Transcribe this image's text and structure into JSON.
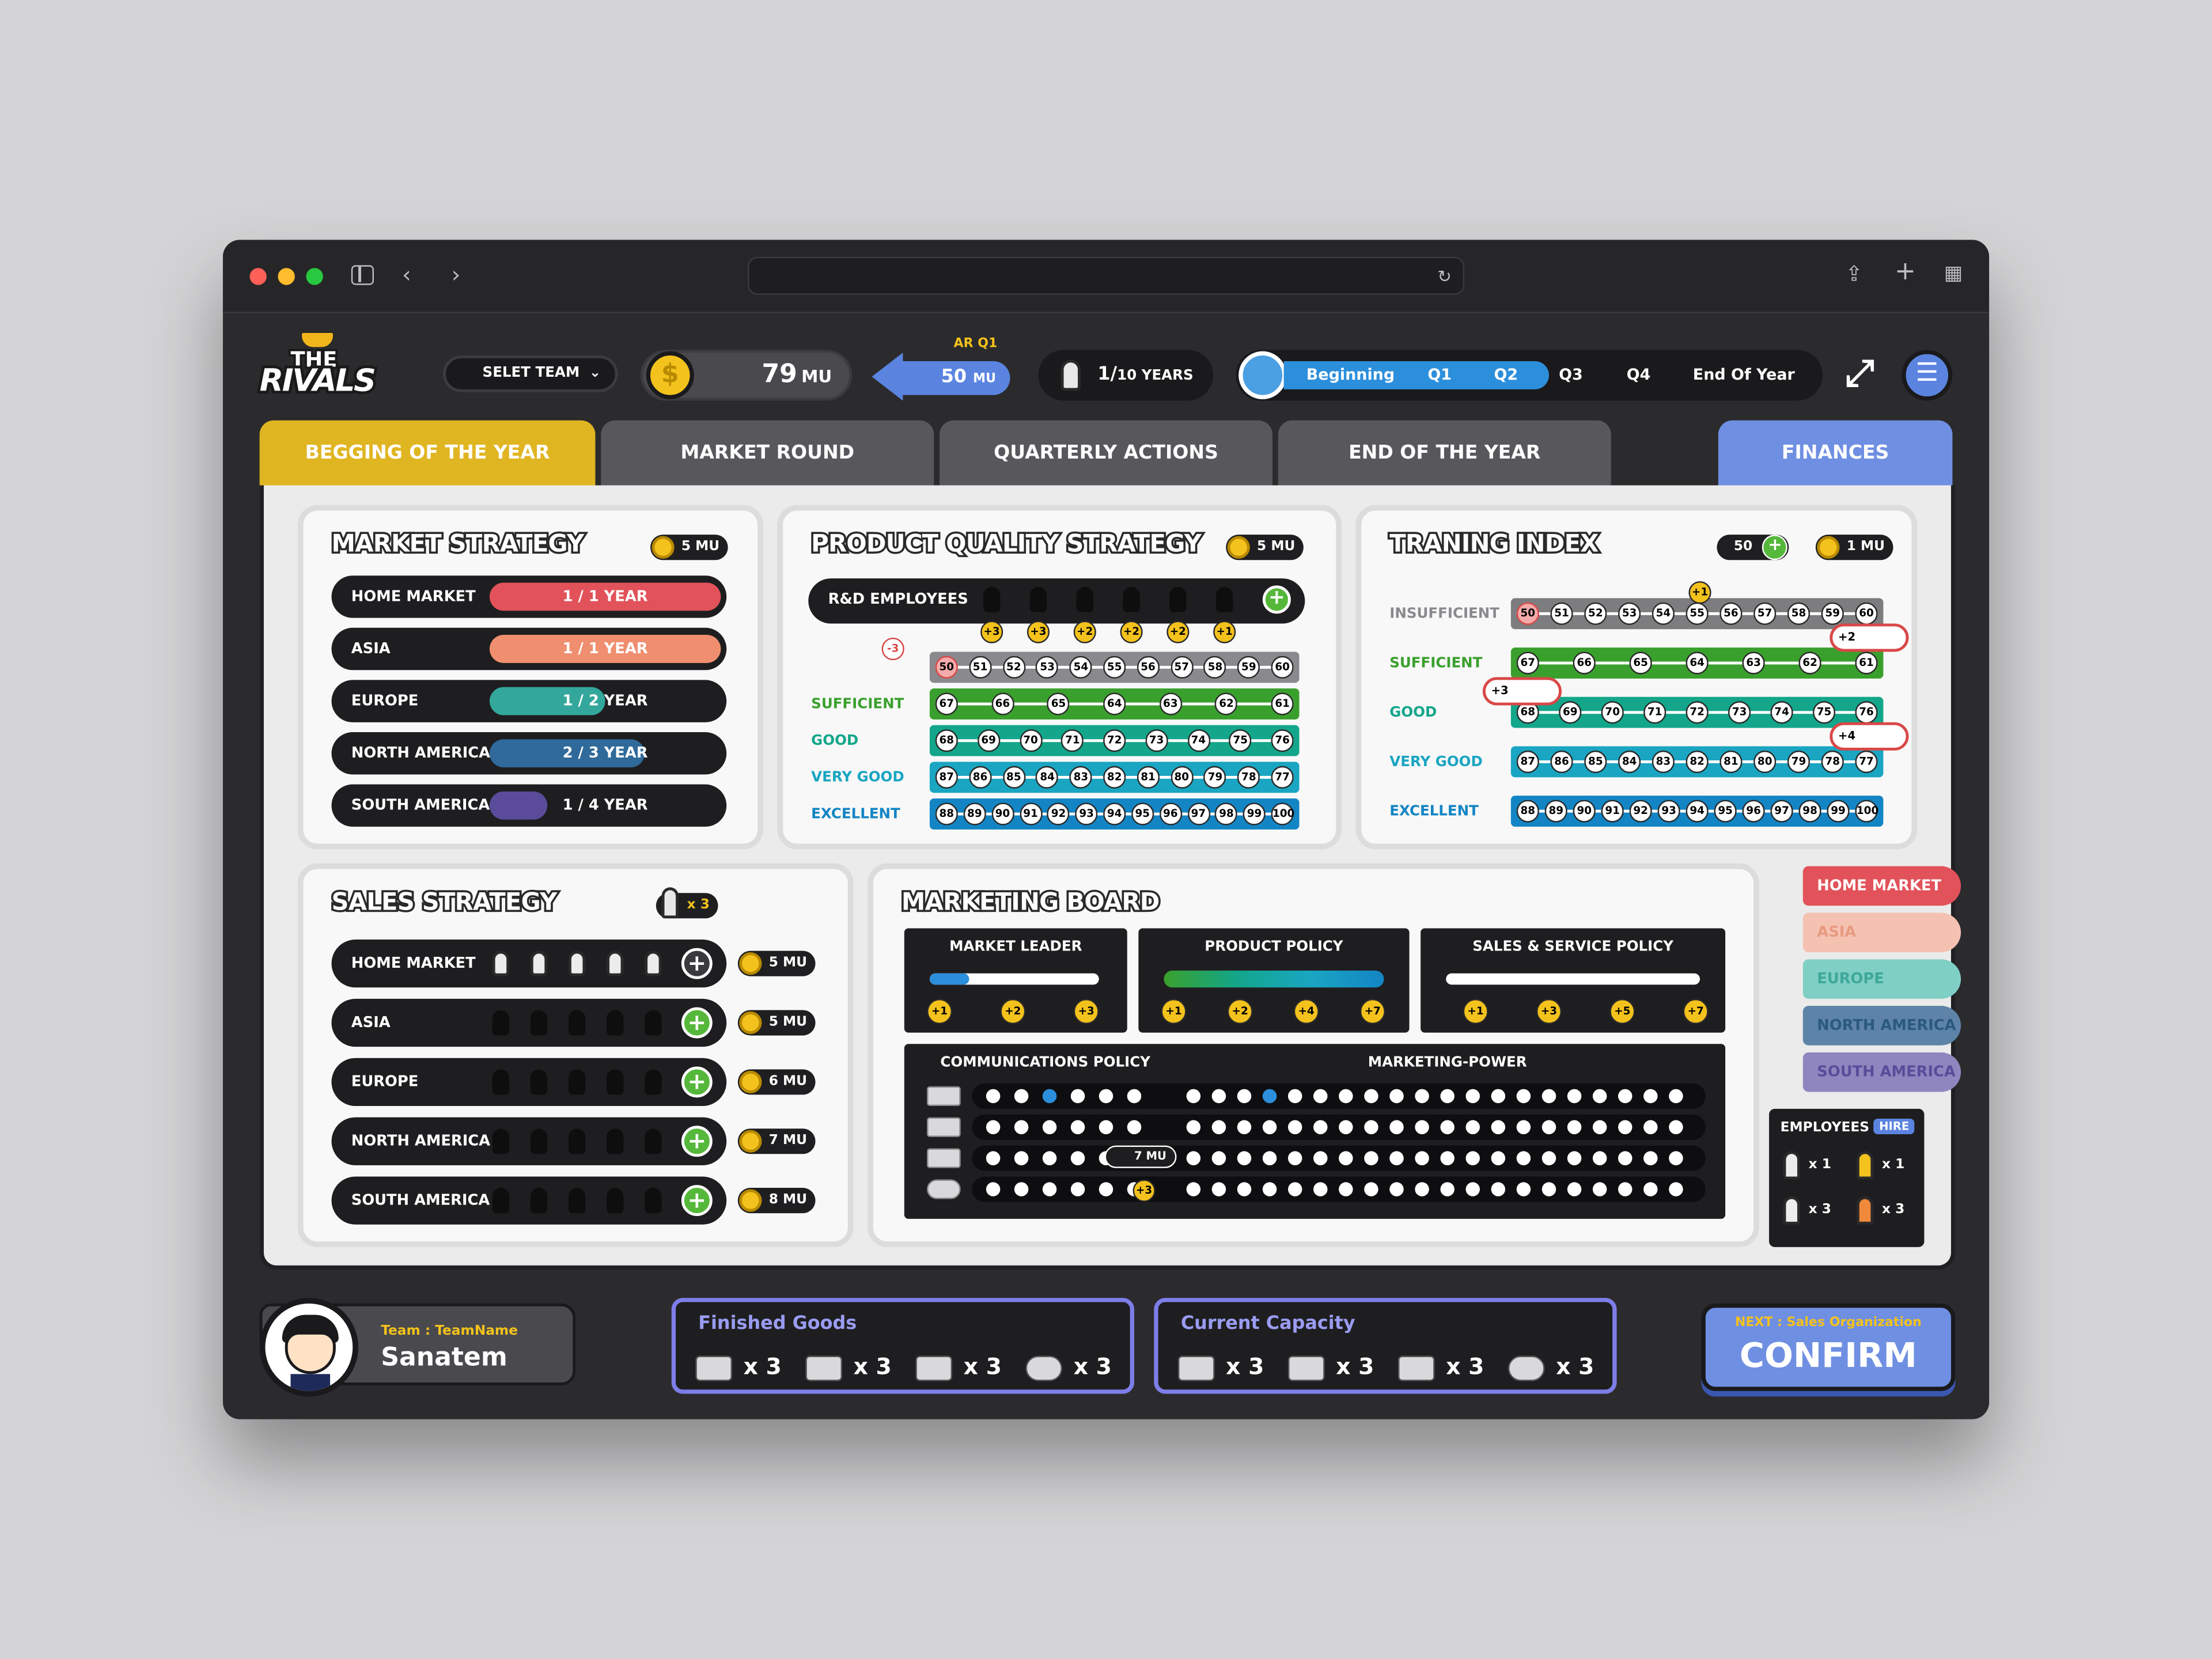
{
  "app": {
    "logo_line1": "THE",
    "logo_line2": "RIVALS",
    "team_select": "SELET TEAM",
    "money": "79",
    "money_unit": "MU",
    "ar_label": "AR Q1",
    "ar_value": "50",
    "ar_unit": "MU",
    "years": "1/",
    "years_suffix": "10 YEARS"
  },
  "timeline": {
    "phases": [
      "Beginning",
      "Q1",
      "Q2",
      "Q3",
      "Q4",
      "End Of Year"
    ],
    "active_through": 2
  },
  "tabs": [
    "BEGGING OF THE YEAR",
    "MARKET ROUND",
    "QUARTERLY ACTIONS",
    "END OF THE YEAR",
    "FINANCES"
  ],
  "market_strategy": {
    "title": "MARKET STRATEGY",
    "cost": "5 MU",
    "rows": [
      {
        "label": "HOME MARKET",
        "value": "1 / 1 YEAR",
        "fill": 1.0,
        "color": "#e2525a"
      },
      {
        "label": "ASIA",
        "value": "1 / 1 YEAR",
        "fill": 1.0,
        "color": "#ef8f6f"
      },
      {
        "label": "EUROPE",
        "value": "1 / 2 YEAR",
        "fill": 0.5,
        "color": "#34a79c"
      },
      {
        "label": "NORTH AMERICA",
        "value": "2 / 3 YEAR",
        "fill": 0.67,
        "color": "#2f6a9a"
      },
      {
        "label": "SOUTH AMERICA",
        "value": "1 / 4 YEAR",
        "fill": 0.25,
        "color": "#5a4c9a"
      }
    ]
  },
  "product_quality": {
    "title": "PRODUCT QUALITY STRATEGY",
    "cost": "5 MU",
    "rd_label": "R&D EMPLOYEES",
    "bonuses": [
      "+3",
      "+3",
      "+2",
      "+2",
      "+2",
      "+1"
    ],
    "penalty": "-3",
    "levels": [
      {
        "label": "SUFFICIENT",
        "color": "#3aa02d",
        "nums": [
          "67",
          "66",
          "65",
          "64",
          "63",
          "62",
          "61"
        ]
      },
      {
        "label": "GOOD",
        "color": "#13a68a",
        "nums": [
          "68",
          "69",
          "70",
          "71",
          "72",
          "73",
          "74",
          "75",
          "76"
        ]
      },
      {
        "label": "VERY GOOD",
        "color": "#1aa5c2",
        "nums": [
          "87",
          "86",
          "85",
          "84",
          "83",
          "82",
          "81",
          "80",
          "79",
          "78",
          "77"
        ]
      },
      {
        "label": "EXCELLENT",
        "color": "#1385c4",
        "nums": [
          "88",
          "89",
          "90",
          "91",
          "92",
          "93",
          "94",
          "95",
          "96",
          "97",
          "98",
          "99",
          "100"
        ]
      }
    ],
    "insufficient": [
      "50",
      "51",
      "52",
      "53",
      "54",
      "55",
      "56",
      "57",
      "58",
      "59",
      "60"
    ]
  },
  "training": {
    "title": "TRANING INDEX",
    "index": "50",
    "cost": "1 MU",
    "bonus": "+1",
    "markers": [
      "+2",
      "+3",
      "+4"
    ],
    "levels": [
      {
        "label": "INSUFFICIENT",
        "color": "#7d7d80",
        "nums": [
          "50",
          "51",
          "52",
          "53",
          "54",
          "55",
          "56",
          "57",
          "58",
          "59",
          "60"
        ]
      },
      {
        "label": "SUFFICIENT",
        "color": "#3aa02d",
        "nums": [
          "67",
          "66",
          "65",
          "64",
          "63",
          "62",
          "61"
        ]
      },
      {
        "label": "GOOD",
        "color": "#13a68a",
        "nums": [
          "68",
          "69",
          "70",
          "71",
          "72",
          "73",
          "74",
          "75",
          "76"
        ]
      },
      {
        "label": "VERY GOOD",
        "color": "#1aa5c2",
        "nums": [
          "87",
          "86",
          "85",
          "84",
          "83",
          "82",
          "81",
          "80",
          "79",
          "78",
          "77"
        ]
      },
      {
        "label": "EXCELLENT",
        "color": "#1385c4",
        "nums": [
          "88",
          "89",
          "90",
          "91",
          "92",
          "93",
          "94",
          "95",
          "96",
          "97",
          "98",
          "99",
          "100"
        ]
      }
    ]
  },
  "sales_strategy": {
    "title": "SALES STRATEGY",
    "badge": "x 3",
    "rows": [
      {
        "label": "HOME MARKET",
        "cost": "5 MU"
      },
      {
        "label": "ASIA",
        "cost": "5 MU"
      },
      {
        "label": "EUROPE",
        "cost": "6 MU"
      },
      {
        "label": "NORTH AMERICA",
        "cost": "7 MU"
      },
      {
        "label": "SOUTH AMERICA",
        "cost": "8 MU"
      }
    ]
  },
  "marketing_board": {
    "title": "MARKETING BOARD",
    "market_leader": {
      "title": "MARKET LEADER",
      "bonuses": [
        "+1",
        "+2",
        "+3"
      ]
    },
    "product_policy": {
      "title": "PRODUCT POLICY",
      "bonuses": [
        "+1",
        "+2",
        "+4",
        "+7"
      ]
    },
    "sales_service": {
      "title": "SALES & SERVICE POLICY",
      "bonuses": [
        "+1",
        "+3",
        "+5",
        "+7"
      ]
    },
    "comm_title": "COMMUNICATIONS POLICY",
    "power_title": "MARKETING-POWER",
    "cost_chip": "7 MU",
    "bonus_chip": "+3"
  },
  "regions": [
    {
      "label": "HOME MARKET",
      "bg": "#e2525a",
      "fg": "#ffffff"
    },
    {
      "label": "ASIA",
      "bg": "#f5c2b1",
      "fg": "#e89a82"
    },
    {
      "label": "EUROPE",
      "bg": "#7fcfc4",
      "fg": "#3ea89a"
    },
    {
      "label": "NORTH AMERICA",
      "bg": "#5d84a8",
      "fg": "#2c5980"
    },
    {
      "label": "SOUTH AMERICA",
      "bg": "#8f86bf",
      "fg": "#5a4c9a"
    }
  ],
  "employees": {
    "title": "EMPLOYEES",
    "hire": "HIRE",
    "counts": [
      "x 1",
      "x 1",
      "x 3",
      "x 3"
    ]
  },
  "footer": {
    "team_label": "Team : TeamName",
    "player": "Sanatem",
    "finished_title": "Finished Goods",
    "finished": [
      "x 3",
      "x 3",
      "x 3",
      "x 3"
    ],
    "capacity_title": "Current Capacity",
    "capacity": [
      "x 3",
      "x 3",
      "x 3",
      "x 3"
    ],
    "next_label": "NEXT : Sales Organization",
    "confirm": "CONFIRM"
  }
}
